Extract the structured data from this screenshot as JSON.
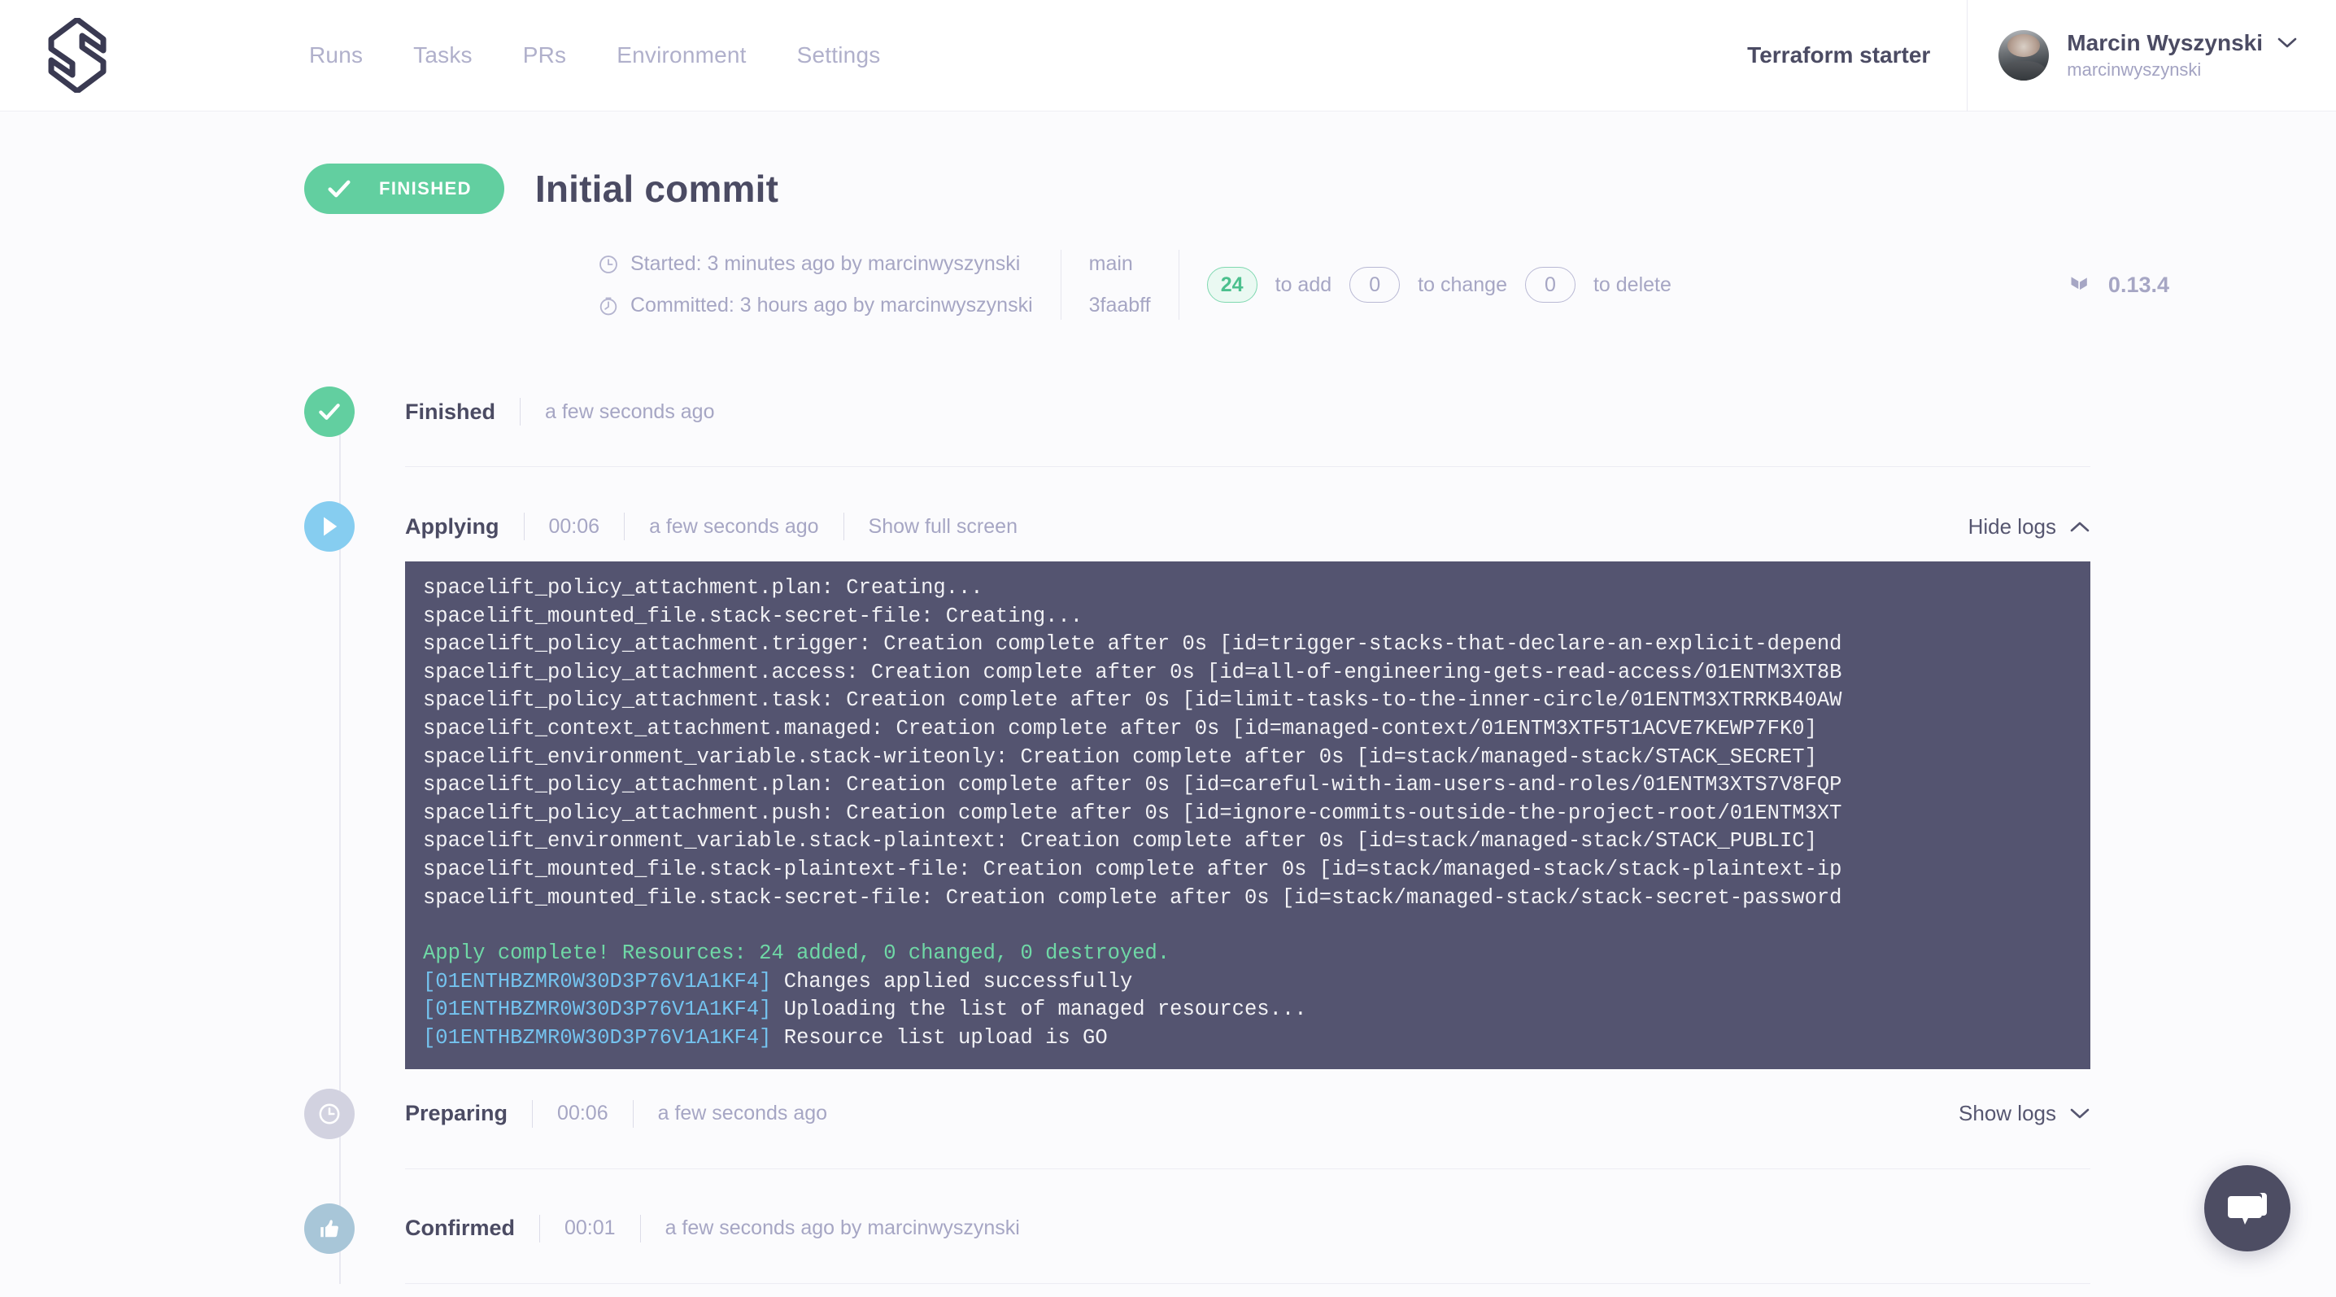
{
  "header": {
    "logo_icon": "spacelift-logo-icon",
    "nav": [
      {
        "label": "Runs"
      },
      {
        "label": "Tasks"
      },
      {
        "label": "PRs"
      },
      {
        "label": "Environment"
      },
      {
        "label": "Settings"
      }
    ],
    "stack_name": "Terraform starter",
    "user": {
      "name": "Marcin Wyszynski",
      "handle": "marcinwyszynski",
      "chevron_icon": "chevron-down-icon",
      "avatar_icon": "user-avatar"
    }
  },
  "run": {
    "status_badge": {
      "label": "FINISHED",
      "icon": "check-icon",
      "color": "#62cfa0"
    },
    "title": "Initial commit",
    "started": "Started: 3 minutes ago by marcinwyszynski",
    "committed": "Committed: 3 hours ago by marcinwyszynski",
    "started_icon": "clock-icon",
    "committed_icon": "stopwatch-icon",
    "branch": "main",
    "commit_sha": "3faabff",
    "counters": [
      {
        "count": "24",
        "label": "to add",
        "highlight": true
      },
      {
        "count": "0",
        "label": "to change",
        "highlight": false
      },
      {
        "count": "0",
        "label": "to delete",
        "highlight": false
      }
    ],
    "terraform_version": "0.13.4",
    "terraform_icon": "terraform-logo-icon"
  },
  "timeline": [
    {
      "name": "Finished",
      "icon": "check-icon",
      "icon_style": "green",
      "duration": null,
      "time": "a few seconds ago",
      "link": null,
      "toggle": null
    },
    {
      "name": "Applying",
      "icon": "play-icon",
      "icon_style": "blue",
      "duration": "00:06",
      "time": "a few seconds ago",
      "link": "Show full screen",
      "toggle": {
        "label": "Hide logs",
        "icon": "chevron-up-icon"
      }
    },
    {
      "name": "Preparing",
      "icon": "clock-icon",
      "icon_style": "grey",
      "duration": "00:06",
      "time": "a few seconds ago",
      "link": null,
      "toggle": {
        "label": "Show logs",
        "icon": "chevron-down-icon"
      }
    },
    {
      "name": "Confirmed",
      "icon": "thumbs-up-icon",
      "icon_style": "steel",
      "duration": "00:01",
      "time": "a few seconds ago by marcinwyszynski",
      "link": null,
      "toggle": null
    }
  ],
  "logs": [
    {
      "text": "spacelift_policy_attachment.plan: Creating...",
      "kind": "plain"
    },
    {
      "text": "spacelift_mounted_file.stack-secret-file: Creating...",
      "kind": "plain"
    },
    {
      "text": "spacelift_policy_attachment.trigger: Creation complete after 0s [id=trigger-stacks-that-declare-an-explicit-depend",
      "kind": "plain"
    },
    {
      "text": "spacelift_policy_attachment.access: Creation complete after 0s [id=all-of-engineering-gets-read-access/01ENTM3XT8B",
      "kind": "plain"
    },
    {
      "text": "spacelift_policy_attachment.task: Creation complete after 0s [id=limit-tasks-to-the-inner-circle/01ENTM3XTRRKB40AW",
      "kind": "plain"
    },
    {
      "text": "spacelift_context_attachment.managed: Creation complete after 0s [id=managed-context/01ENTM3XTF5T1ACVE7KEWP7FK0]",
      "kind": "plain"
    },
    {
      "text": "spacelift_environment_variable.stack-writeonly: Creation complete after 0s [id=stack/managed-stack/STACK_SECRET]",
      "kind": "plain"
    },
    {
      "text": "spacelift_policy_attachment.plan: Creation complete after 0s [id=careful-with-iam-users-and-roles/01ENTM3XTS7V8FQP",
      "kind": "plain"
    },
    {
      "text": "spacelift_policy_attachment.push: Creation complete after 0s [id=ignore-commits-outside-the-project-root/01ENTM3XT",
      "kind": "plain"
    },
    {
      "text": "spacelift_environment_variable.stack-plaintext: Creation complete after 0s [id=stack/managed-stack/STACK_PUBLIC]",
      "kind": "plain"
    },
    {
      "text": "spacelift_mounted_file.stack-plaintext-file: Creation complete after 0s [id=stack/managed-stack/stack-plaintext-ip",
      "kind": "plain"
    },
    {
      "text": "spacelift_mounted_file.stack-secret-file: Creation complete after 0s [id=stack/managed-stack/stack-secret-password",
      "kind": "plain"
    },
    {
      "text": "",
      "kind": "gap"
    },
    {
      "text": "Apply complete! Resources: 24 added, 0 changed, 0 destroyed.",
      "kind": "green"
    },
    {
      "id": "[01ENTHBZMR0W30D3P76V1A1KF4]",
      "text": " Changes applied successfully",
      "kind": "id"
    },
    {
      "id": "[01ENTHBZMR0W30D3P76V1A1KF4]",
      "text": " Uploading the list of managed resources...",
      "kind": "id"
    },
    {
      "id": "[01ENTHBZMR0W30D3P76V1A1KF4]",
      "text": " Resource list upload is GO",
      "kind": "id"
    }
  ],
  "chat": {
    "icon": "chat-bubble-icon"
  },
  "colors": {
    "accent_green": "#62cfa0",
    "accent_blue": "#86cdf0",
    "log_bg": "#545470",
    "text_dark": "#4b4b63",
    "text_muted": "#a6a6c4"
  }
}
